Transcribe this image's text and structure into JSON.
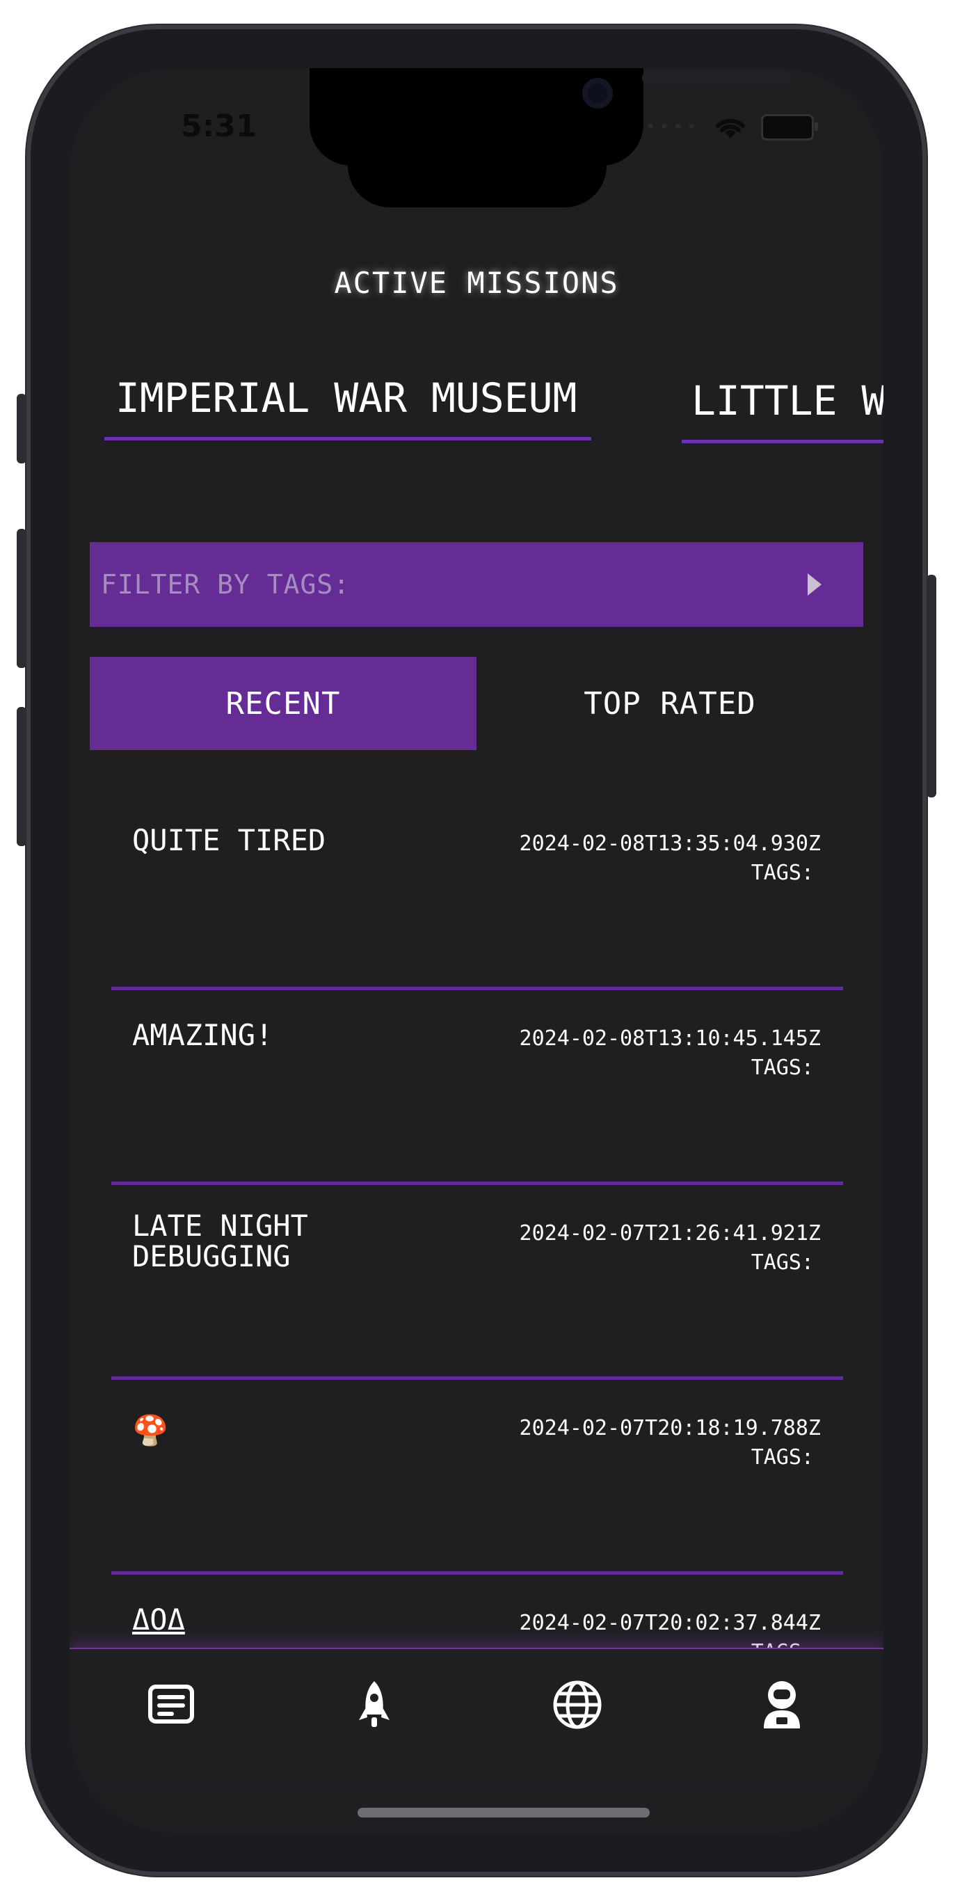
{
  "status_bar": {
    "time": "5:31"
  },
  "header": {
    "title": "ACTIVE MISSIONS"
  },
  "missions": {
    "tabs": [
      {
        "label": "IMPERIAL WAR MUSEUM"
      },
      {
        "label": "LITTLE W"
      }
    ]
  },
  "filter": {
    "label": "FILTER BY TAGS:"
  },
  "sort": {
    "recent_label": "RECENT",
    "top_rated_label": "TOP RATED"
  },
  "entries": [
    {
      "title": "QUITE TIRED",
      "timestamp": "2024-02-08T13:35:04.930Z",
      "tags_label": "TAGS:"
    },
    {
      "title": "AMAZING!",
      "timestamp": "2024-02-08T13:10:45.145Z",
      "tags_label": "TAGS:"
    },
    {
      "title": "LATE NIGHT DEBUGGING",
      "timestamp": "2024-02-07T21:26:41.921Z",
      "tags_label": "TAGS:"
    },
    {
      "title": "🍄",
      "timestamp": "2024-02-07T20:18:19.788Z",
      "tags_label": "TAGS:"
    },
    {
      "title": "ΔΟΔ",
      "timestamp": "2024-02-07T20:02:37.844Z",
      "tags_label": "TAGS:"
    }
  ],
  "tabbar": {
    "items": [
      {
        "icon": "feed-icon"
      },
      {
        "icon": "rocket-icon"
      },
      {
        "icon": "globe-icon"
      },
      {
        "icon": "astronaut-icon"
      }
    ]
  },
  "colors": {
    "accent": "#652c95",
    "background": "#1f1f21",
    "text": "#ffffff"
  }
}
